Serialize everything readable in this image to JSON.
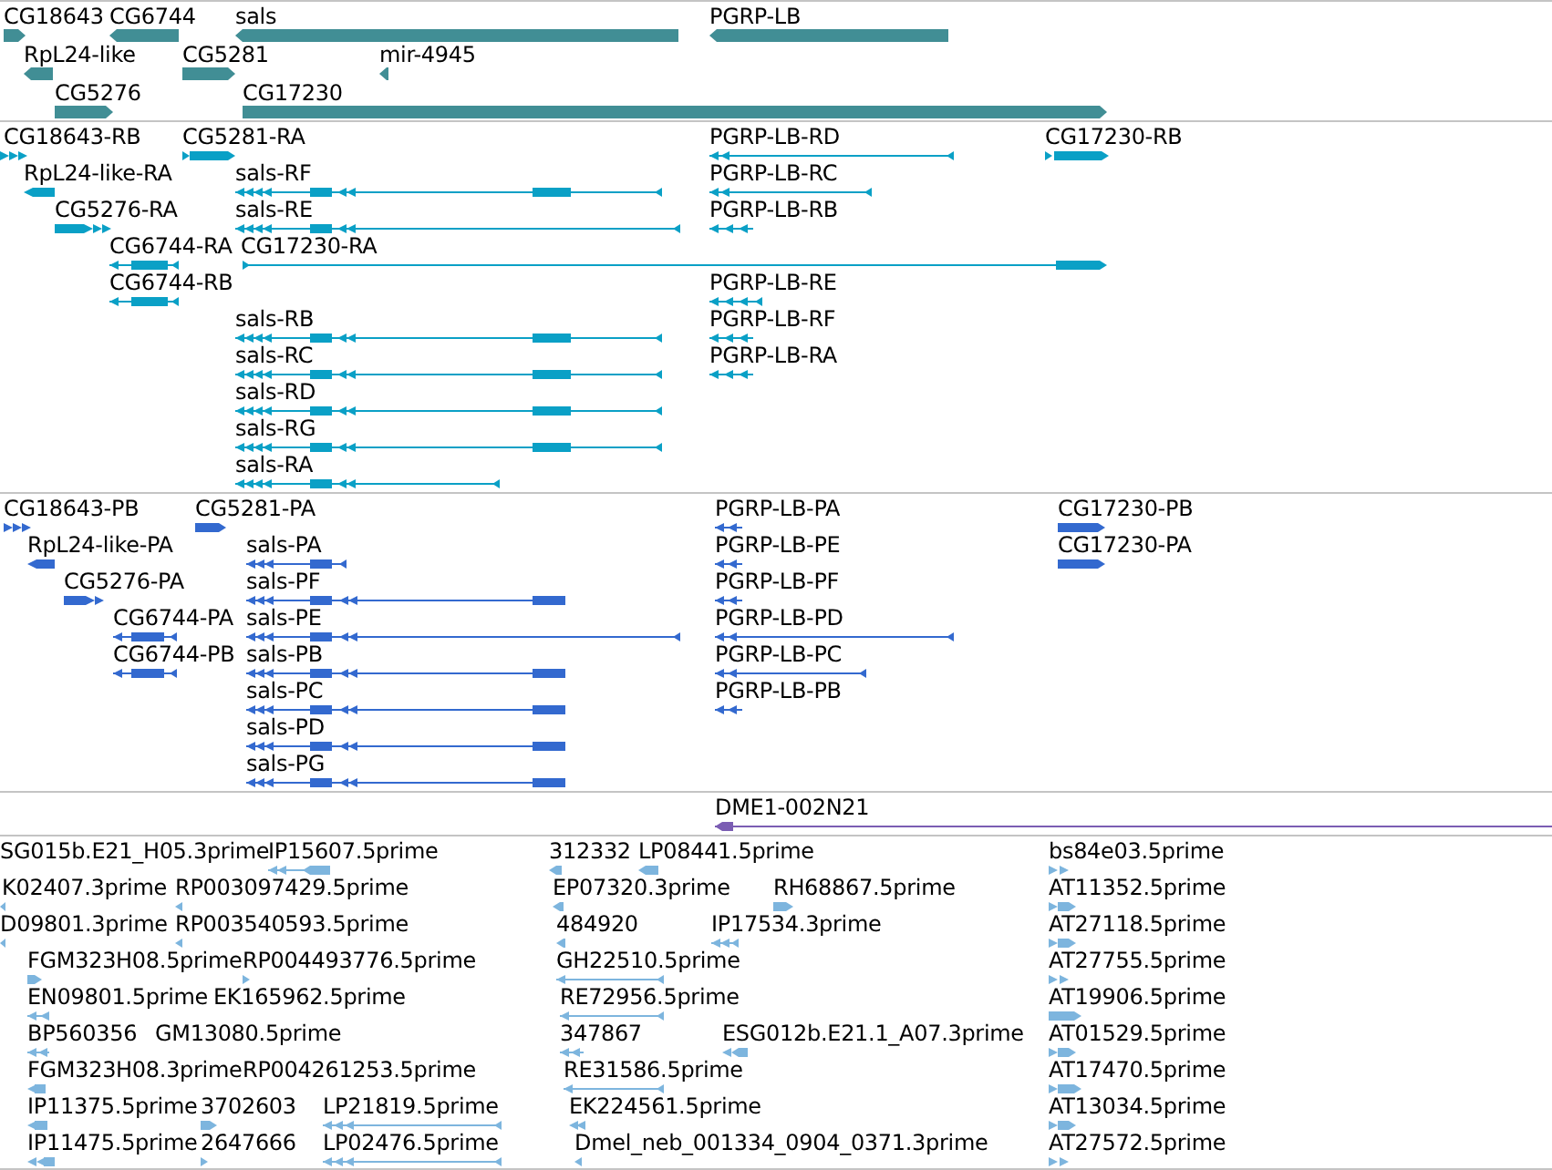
{
  "tracks": [
    {
      "kind": "gene",
      "color": "#418e95",
      "features": [
        {
          "label": "CG18643",
          "reverse": false
        },
        {
          "label": "CG6744",
          "reverse": true
        },
        {
          "label": "sals",
          "reverse": true
        },
        {
          "label": "PGRP-LB",
          "reverse": true
        },
        {
          "label": "RpL24-like",
          "reverse": true
        },
        {
          "label": "CG5281",
          "reverse": false
        },
        {
          "label": "mir-4945",
          "reverse": true
        },
        {
          "label": "CG5276",
          "reverse": false
        },
        {
          "label": "CG17230",
          "reverse": false
        }
      ]
    },
    {
      "kind": "transcript",
      "color": "#0aa0c6",
      "features": [
        {
          "label": "CG18643-RB",
          "reverse": false
        },
        {
          "label": "CG5281-RA",
          "reverse": false
        },
        {
          "label": "PGRP-LB-RD",
          "reverse": true
        },
        {
          "label": "CG17230-RB",
          "reverse": false
        },
        {
          "label": "RpL24-like-RA",
          "reverse": true
        },
        {
          "label": "sals-RF",
          "reverse": true
        },
        {
          "label": "PGRP-LB-RC",
          "reverse": true
        },
        {
          "label": "CG5276-RA",
          "reverse": false
        },
        {
          "label": "sals-RE",
          "reverse": true
        },
        {
          "label": "PGRP-LB-RB",
          "reverse": true
        },
        {
          "label": "CG6744-RA",
          "reverse": true
        },
        {
          "label": "CG17230-RA",
          "reverse": false
        },
        {
          "label": "CG6744-RB",
          "reverse": true
        },
        {
          "label": "PGRP-LB-RE",
          "reverse": true
        },
        {
          "label": "sals-RB",
          "reverse": true
        },
        {
          "label": "PGRP-LB-RF",
          "reverse": true
        },
        {
          "label": "sals-RC",
          "reverse": true
        },
        {
          "label": "PGRP-LB-RA",
          "reverse": true
        },
        {
          "label": "sals-RD",
          "reverse": true
        },
        {
          "label": "sals-RG",
          "reverse": true
        },
        {
          "label": "sals-RA",
          "reverse": true
        }
      ]
    },
    {
      "kind": "protein",
      "color": "#3369cf",
      "features": [
        {
          "label": "CG18643-PB",
          "reverse": false
        },
        {
          "label": "CG5281-PA",
          "reverse": false
        },
        {
          "label": "PGRP-LB-PA",
          "reverse": true
        },
        {
          "label": "CG17230-PB",
          "reverse": false
        },
        {
          "label": "RpL24-like-PA",
          "reverse": true
        },
        {
          "label": "sals-PA",
          "reverse": true
        },
        {
          "label": "PGRP-LB-PE",
          "reverse": true
        },
        {
          "label": "CG17230-PA",
          "reverse": false
        },
        {
          "label": "CG5276-PA",
          "reverse": false
        },
        {
          "label": "sals-PF",
          "reverse": true
        },
        {
          "label": "PGRP-LB-PF",
          "reverse": true
        },
        {
          "label": "CG6744-PA",
          "reverse": true
        },
        {
          "label": "sals-PE",
          "reverse": true
        },
        {
          "label": "PGRP-LB-PD",
          "reverse": true
        },
        {
          "label": "CG6744-PB",
          "reverse": true
        },
        {
          "label": "sals-PB",
          "reverse": true
        },
        {
          "label": "PGRP-LB-PC",
          "reverse": true
        },
        {
          "label": "sals-PC",
          "reverse": true
        },
        {
          "label": "PGRP-LB-PB",
          "reverse": true
        },
        {
          "label": "sals-PD",
          "reverse": true
        },
        {
          "label": "sals-PG",
          "reverse": true
        }
      ]
    },
    {
      "kind": "clone",
      "color": "#7b5db3",
      "features": [
        {
          "label": "DME1-002N21",
          "reverse": true
        }
      ]
    },
    {
      "kind": "est",
      "color": "#7db5de",
      "features": [
        {
          "label": "SG015b.E21_H05.3prime"
        },
        {
          "label": "IP15607.5prime",
          "reverse": true
        },
        {
          "label": "312332",
          "reverse": true
        },
        {
          "label": "LP08441.5prime",
          "reverse": true
        },
        {
          "label": "bs84e03.5prime",
          "reverse": false
        },
        {
          "label": "K02407.3prime",
          "reverse": true
        },
        {
          "label": "RP003097429.5prime",
          "reverse": true
        },
        {
          "label": "EP07320.3prime",
          "reverse": true
        },
        {
          "label": "RH68867.5prime",
          "reverse": false
        },
        {
          "label": "AT11352.5prime",
          "reverse": false
        },
        {
          "label": "D09801.3prime",
          "reverse": true
        },
        {
          "label": "RP003540593.5prime",
          "reverse": true
        },
        {
          "label": "484920",
          "reverse": true
        },
        {
          "label": "IP17534.3prime",
          "reverse": true
        },
        {
          "label": "AT27118.5prime",
          "reverse": false
        },
        {
          "label": "FGM323H08.5prime",
          "reverse": false
        },
        {
          "label": "RP004493776.5prime",
          "reverse": false
        },
        {
          "label": "GH22510.5prime",
          "reverse": true
        },
        {
          "label": "AT27755.5prime",
          "reverse": false
        },
        {
          "label": "EN09801.5prime",
          "reverse": true
        },
        {
          "label": "EK165962.5prime"
        },
        {
          "label": "RE72956.5prime",
          "reverse": true
        },
        {
          "label": "AT19906.5prime",
          "reverse": false
        },
        {
          "label": "BP560356",
          "reverse": true
        },
        {
          "label": "GM13080.5prime"
        },
        {
          "label": "347867",
          "reverse": true
        },
        {
          "label": "ESG012b.E21.1_A07.3prime",
          "reverse": true
        },
        {
          "label": "AT01529.5prime",
          "reverse": false
        },
        {
          "label": "FGM323H08.3prime",
          "reverse": true
        },
        {
          "label": "RP004261253.5prime"
        },
        {
          "label": "RE31586.5prime",
          "reverse": true
        },
        {
          "label": "AT17470.5prime",
          "reverse": false
        },
        {
          "label": "IP11375.5prime",
          "reverse": true
        },
        {
          "label": "3702603",
          "reverse": false
        },
        {
          "label": "LP21819.5prime",
          "reverse": true
        },
        {
          "label": "EK224561.5prime",
          "reverse": true
        },
        {
          "label": "AT13034.5prime",
          "reverse": false
        },
        {
          "label": "IP11475.5prime",
          "reverse": true
        },
        {
          "label": "2647666",
          "reverse": false
        },
        {
          "label": "LP02476.5prime",
          "reverse": true
        },
        {
          "label": "Dmel_neb_001334_0904_0371.3prime",
          "reverse": true
        },
        {
          "label": "AT27572.5prime",
          "reverse": false
        }
      ]
    }
  ]
}
